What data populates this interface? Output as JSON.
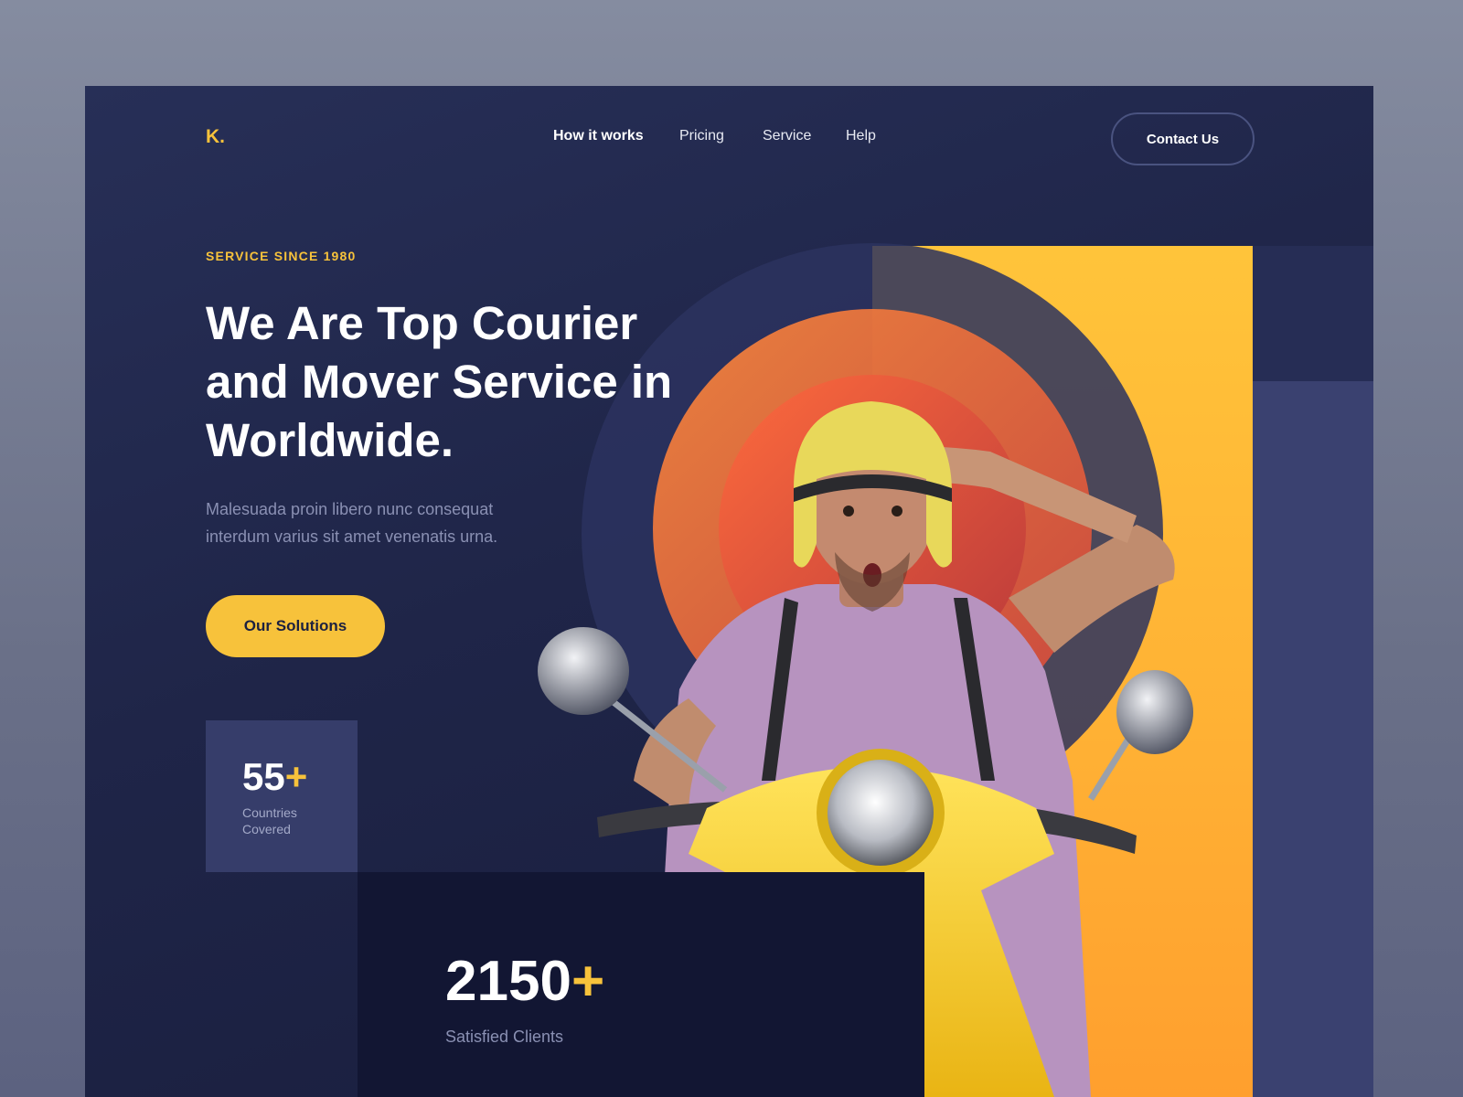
{
  "nav": {
    "logo": "K.",
    "links": [
      "How it works",
      "Pricing",
      "Service",
      "Help"
    ],
    "contact": "Contact Us"
  },
  "hero": {
    "eyebrow": "SERVICE SINCE 1980",
    "headline": "We Are Top Courier and Mover Service in Worldwide.",
    "subtext": "Malesuada proin libero nunc consequat interdum varius sit amet venenatis urna.",
    "cta": "Our Solutions"
  },
  "stats": [
    {
      "number": "55",
      "suffix": "+",
      "label": "Countries Covered"
    },
    {
      "number": "2150",
      "suffix": "+",
      "label": "Satisfied Clients"
    }
  ],
  "colors": {
    "accent": "#f7c23b",
    "background": "#1f2548",
    "panel": "#ffb034"
  }
}
